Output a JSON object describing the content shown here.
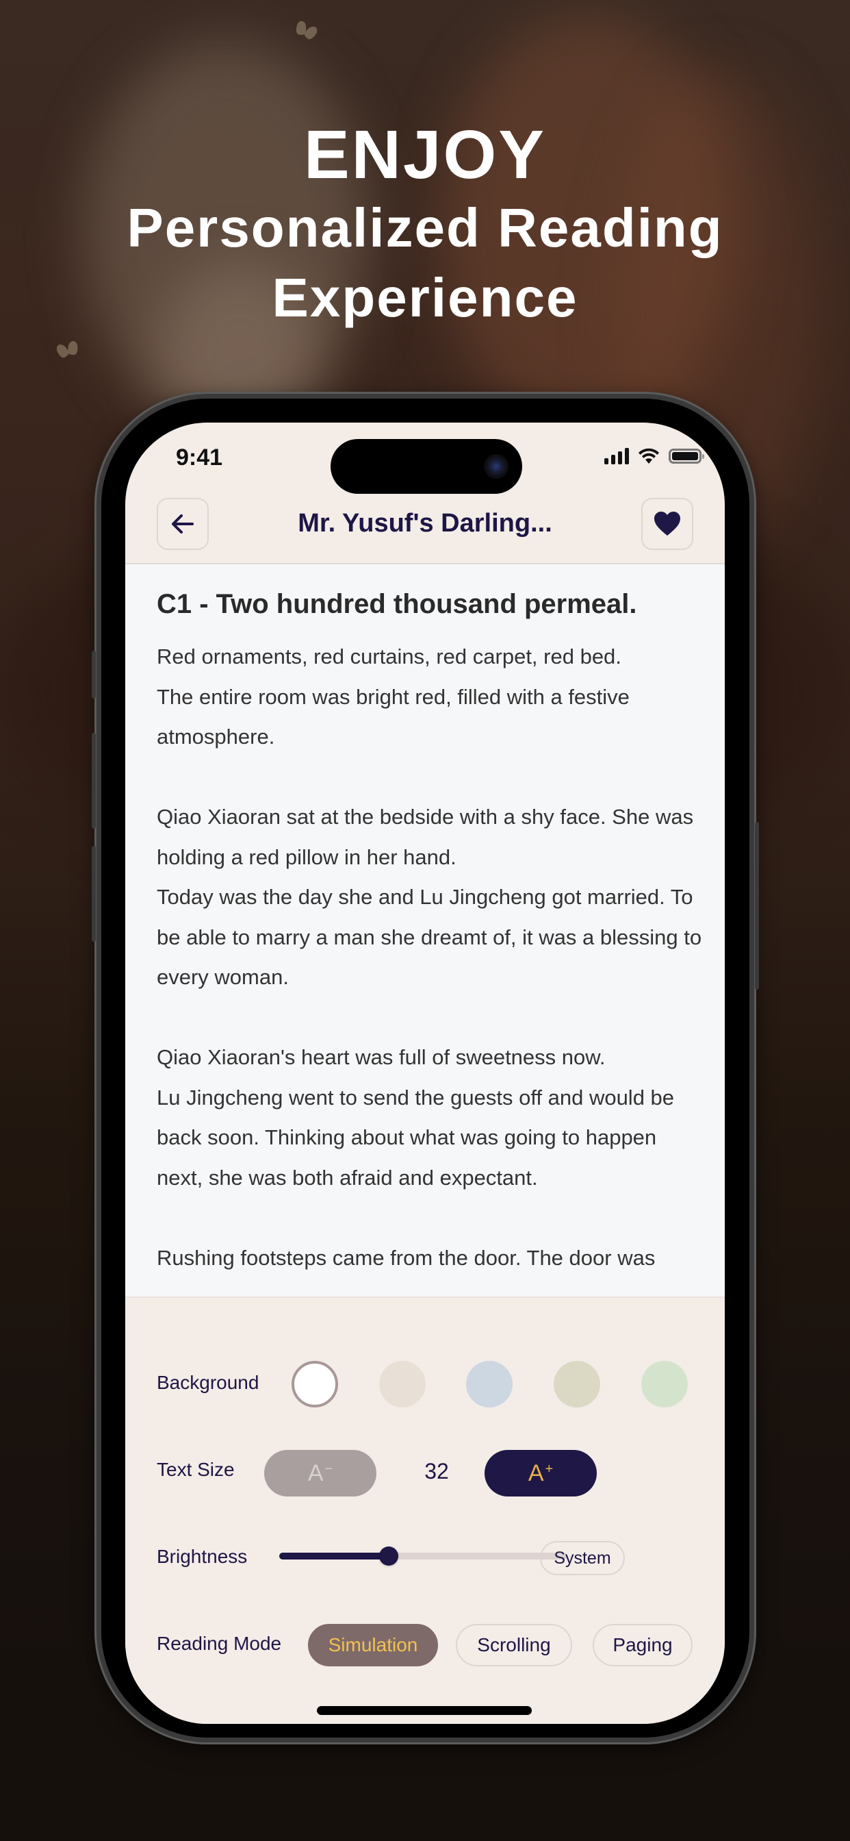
{
  "hero": {
    "line1": "ENJOY",
    "line2": "Personalized Reading",
    "line3": "Experience"
  },
  "status_bar": {
    "time": "9:41",
    "icons": [
      "cellular-signal-icon",
      "wifi-icon",
      "battery-icon"
    ]
  },
  "nav": {
    "back_icon": "arrow-left-icon",
    "title": "Mr. Yusuf's Darling...",
    "favorite_icon": "heart-icon"
  },
  "reader": {
    "chapter_title": "C1 - Two hundred thousand permeal.",
    "paragraphs": [
      "Red ornaments, red curtains, red carpet, red bed.",
      "The entire room was bright red, filled with a festive atmosphere.",
      "",
      "Qiao Xiaoran sat at the bedside with a shy face. She was holding a red pillow in her hand.",
      "Today was the day she and Lu Jingcheng got married. To be able to marry a man she dreamt of, it was a blessing to every woman.",
      "",
      "Qiao Xiaoran's heart was full of sweetness now.",
      "Lu Jingcheng went to send the guests off and would be back soon. Thinking about what was going to happen next, she was both afraid and expectant.",
      "",
      "Rushing footsteps came from the door. The door was"
    ]
  },
  "settings": {
    "background": {
      "label": "Background",
      "options": [
        {
          "name": "white",
          "color": "#ffffff",
          "selected": true
        },
        {
          "name": "beige",
          "color": "#e8dfd6",
          "selected": false
        },
        {
          "name": "blue",
          "color": "#ccd7e2",
          "selected": false
        },
        {
          "name": "olive",
          "color": "#dbd9c4",
          "selected": false
        },
        {
          "name": "green",
          "color": "#d4e4cc",
          "selected": false
        }
      ]
    },
    "text_size": {
      "label": "Text Size",
      "decrease_label": "A",
      "decrease_sup": "−",
      "value": "32",
      "increase_label": "A",
      "increase_sup": "+"
    },
    "brightness": {
      "label": "Brightness",
      "value_fraction": 0.38,
      "system_label": "System"
    },
    "reading_mode": {
      "label": "Reading Mode",
      "options": [
        {
          "label": "Simulation",
          "active": true
        },
        {
          "label": "Scrolling",
          "active": false
        },
        {
          "label": "Paging",
          "active": false
        }
      ]
    }
  },
  "colors": {
    "accent_dark": "#1f1745",
    "accent_gold": "#f0c250",
    "panel_bg": "#f4ece7",
    "reader_bg": "#f6f7f9"
  }
}
